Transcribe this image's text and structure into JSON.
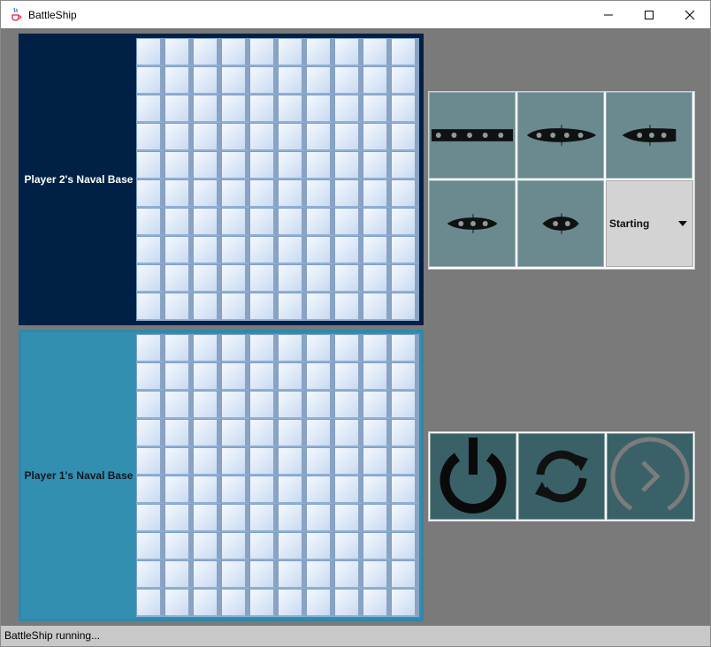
{
  "window": {
    "title": "BattleShip",
    "icon": "java-cup-icon",
    "controls": [
      "minimize-icon",
      "maximize-icon",
      "close-icon"
    ]
  },
  "boards": {
    "player2": {
      "label": "Player 2's Naval Base",
      "rows": 10,
      "cols": 10,
      "color": "#002145"
    },
    "player1": {
      "label": "Player 1's Naval Base",
      "rows": 10,
      "cols": 10,
      "color": "#338fb0"
    }
  },
  "ships": [
    {
      "name": "carrier-icon",
      "length": 5
    },
    {
      "name": "battleship-icon",
      "length": 4
    },
    {
      "name": "cruiser-icon",
      "length": 3
    },
    {
      "name": "submarine-icon",
      "length": 3
    },
    {
      "name": "destroyer-icon",
      "length": 2
    }
  ],
  "phase_select": {
    "value": "Starting"
  },
  "controls": [
    {
      "name": "power-icon"
    },
    {
      "name": "rotate-icon"
    },
    {
      "name": "next-icon"
    }
  ],
  "status": {
    "text": "BattleShip running..."
  }
}
